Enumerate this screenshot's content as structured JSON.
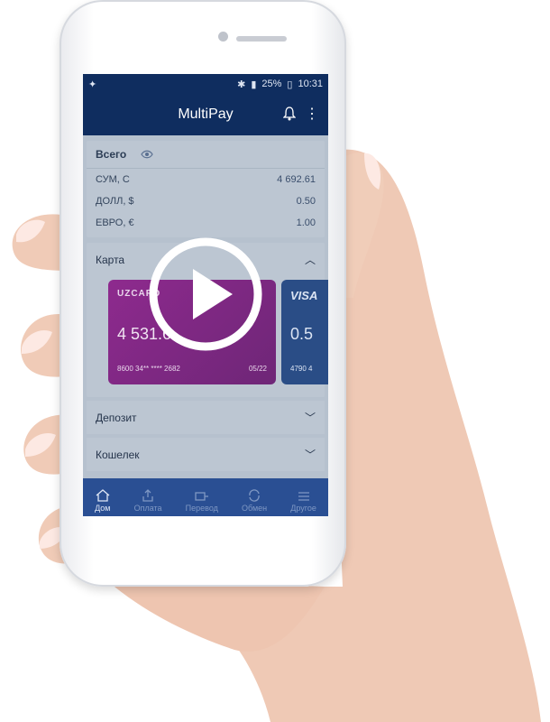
{
  "status_bar": {
    "battery": "25%",
    "time": "10:31"
  },
  "app_bar": {
    "title": "MultiPay"
  },
  "total": {
    "label": "Всего",
    "rows": [
      {
        "label": "СУМ, С",
        "value": "4 692.61"
      },
      {
        "label": "ДОЛЛ, $",
        "value": "0.50"
      },
      {
        "label": "ЕВРО, €",
        "value": "1.00"
      }
    ]
  },
  "cards_section": {
    "label": "Карта",
    "cards": [
      {
        "brand": "UZCARD",
        "amount": "4 531.6",
        "number": "8600 34** **** 2682",
        "expiry": "05/22"
      },
      {
        "brand": "VISA",
        "amount": "0.5",
        "number": "4790 4"
      }
    ]
  },
  "sections": [
    {
      "label": "Депозит"
    },
    {
      "label": "Кошелек"
    }
  ],
  "bottom_nav": [
    {
      "label": "Дом",
      "icon": "home-icon"
    },
    {
      "label": "Оплата",
      "icon": "pay-icon"
    },
    {
      "label": "Перевод",
      "icon": "transfer-icon"
    },
    {
      "label": "Обмен",
      "icon": "exchange-icon"
    },
    {
      "label": "Другое",
      "icon": "menu-icon"
    }
  ],
  "colors": {
    "header": "#0f2d5f",
    "nav": "#2a4f93",
    "card_purple": "#8e2a8e",
    "card_blue": "#2a4d86"
  }
}
